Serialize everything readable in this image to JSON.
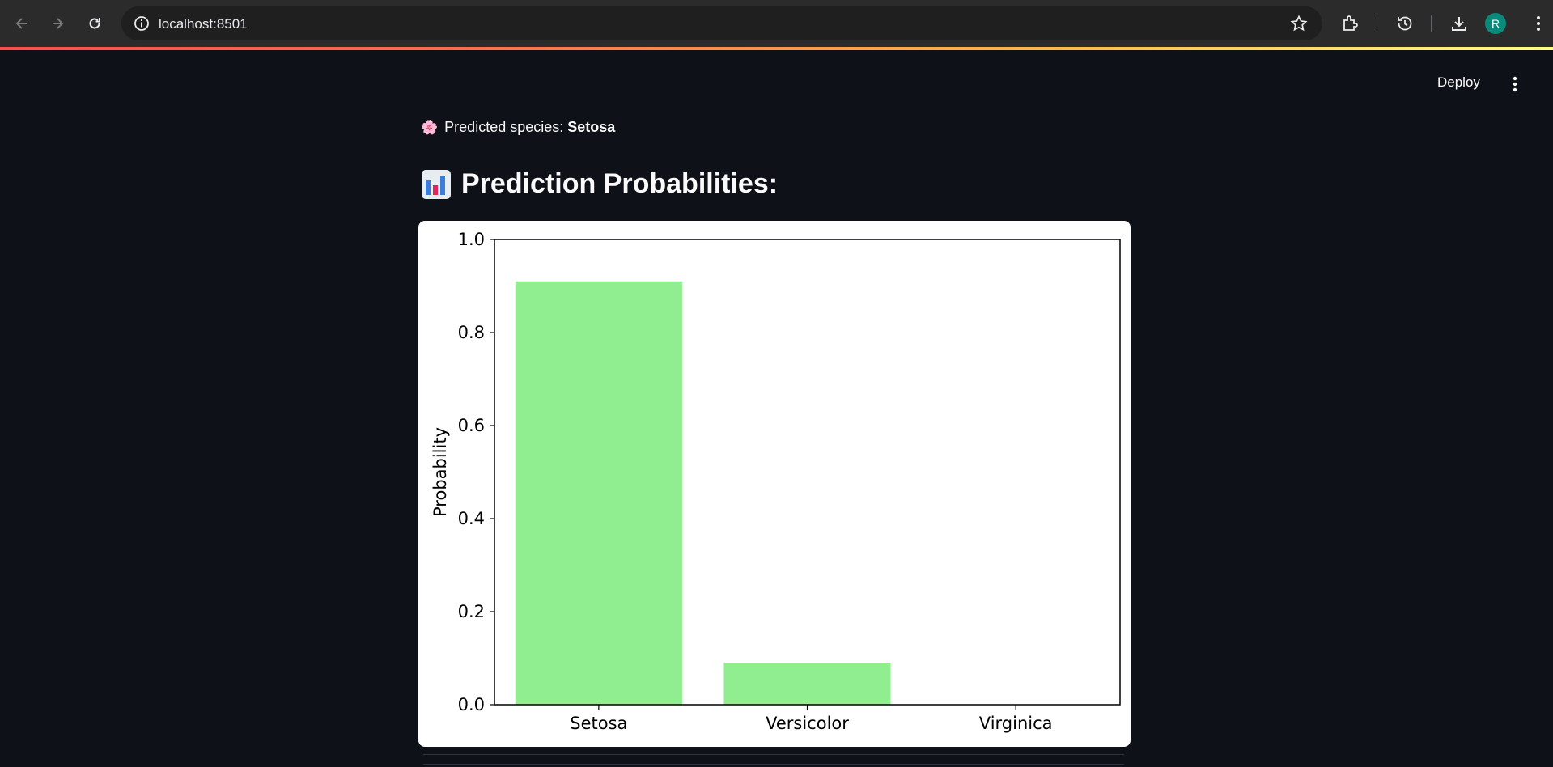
{
  "browser": {
    "url": "localhost:8501",
    "profile_initial": "R",
    "icons": [
      "back-icon",
      "forward-icon",
      "reload-icon",
      "site-info-icon",
      "bookmark-star-icon",
      "extensions-icon",
      "history-icon",
      "download-icon"
    ]
  },
  "header": {
    "deploy_label": "Deploy",
    "menu_icon": "kebab-menu-icon"
  },
  "content": {
    "prediction_emoji": "🌸",
    "prediction_prefix": "Predicted species:",
    "prediction_value": "Setosa",
    "heading_icon": "bar-chart-icon",
    "heading": "Prediction Probabilities:"
  },
  "colors": {
    "background": "#0e1117",
    "bar": "#90ee90",
    "accent_gradient_start": "#ff4b4b",
    "accent_gradient_end": "#fffd80"
  },
  "chart_data": {
    "type": "bar",
    "categories": [
      "Setosa",
      "Versicolor",
      "Virginica"
    ],
    "values": [
      0.91,
      0.09,
      0.0
    ],
    "xlabel": "",
    "ylabel": "Probability",
    "ylim": [
      0.0,
      1.0
    ],
    "yticks": [
      "0.0",
      "0.2",
      "0.4",
      "0.6",
      "0.8",
      "1.0"
    ],
    "grid": false,
    "legend": "none"
  }
}
